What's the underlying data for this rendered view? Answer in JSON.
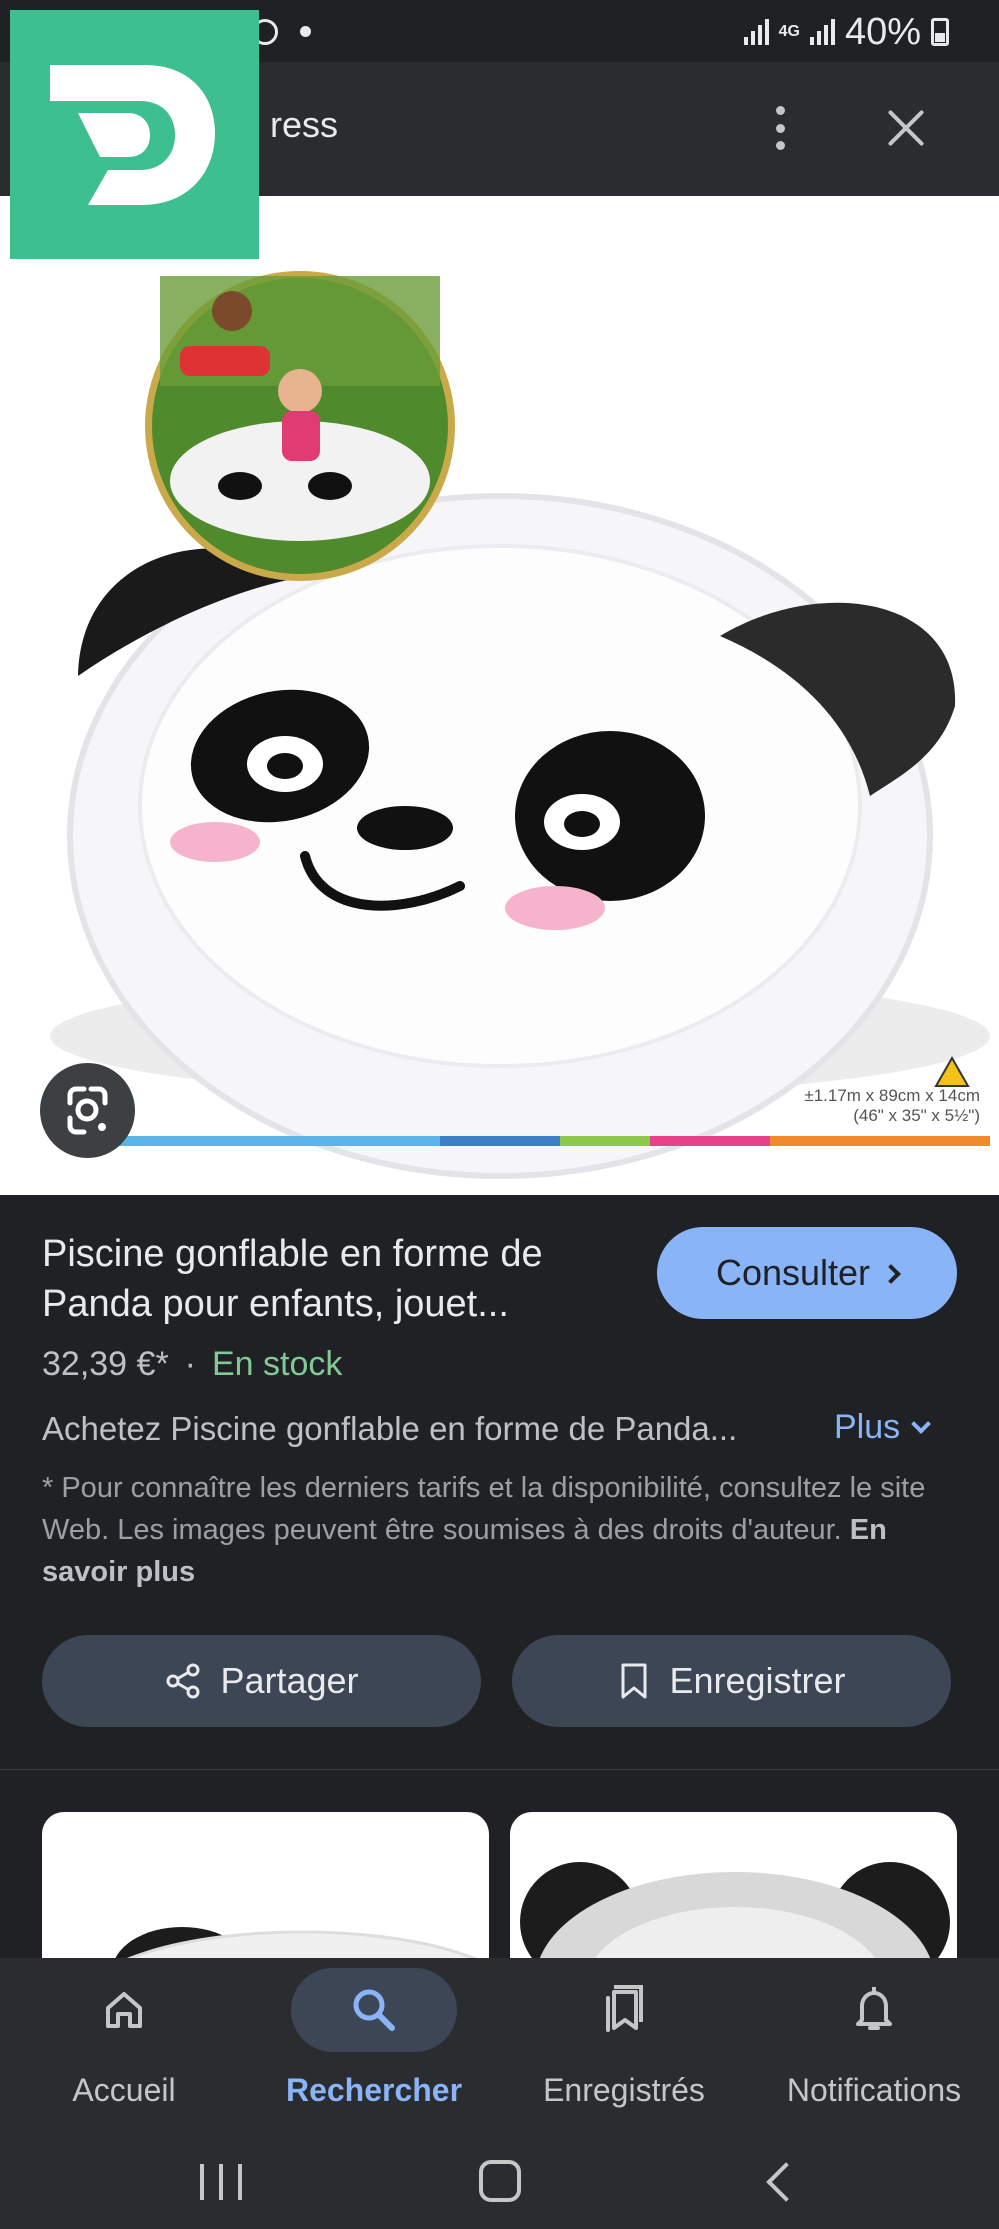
{
  "status_bar": {
    "battery": "40%",
    "network": "4G"
  },
  "header": {
    "site_name": "ress"
  },
  "product": {
    "title": "Piscine gonflable en forme de Panda pour enfants, jouet...",
    "price": "32,39 €*",
    "separator": "·",
    "stock": "En stock",
    "consult_label": "Consulter",
    "description": "Achetez Piscine gonflable en forme de Panda...",
    "more_label": "Plus",
    "disclaimer": "* Pour connaître les derniers tarifs et la disponibilité, consultez le site Web. Les images peuvent être soumises à des droits d'auteur.",
    "learn_more": "En savoir plus",
    "image_dimensions_line1": "±1.17m x 89cm x 14cm",
    "image_dimensions_line2": "(46\" x 35\" x 5½\")"
  },
  "actions": {
    "share_label": "Partager",
    "save_label": "Enregistrer"
  },
  "bottom_nav": {
    "items": [
      {
        "label": "Accueil",
        "icon": "home-icon"
      },
      {
        "label": "Rechercher",
        "icon": "search-icon",
        "active": true
      },
      {
        "label": "Enregistrés",
        "icon": "collections-icon"
      },
      {
        "label": "Notifications",
        "icon": "bell-icon"
      }
    ]
  },
  "colors": {
    "accent": "#8ab4f8",
    "stock_green": "#81c995",
    "logo_green": "#3ebf8f",
    "background": "#202124"
  }
}
